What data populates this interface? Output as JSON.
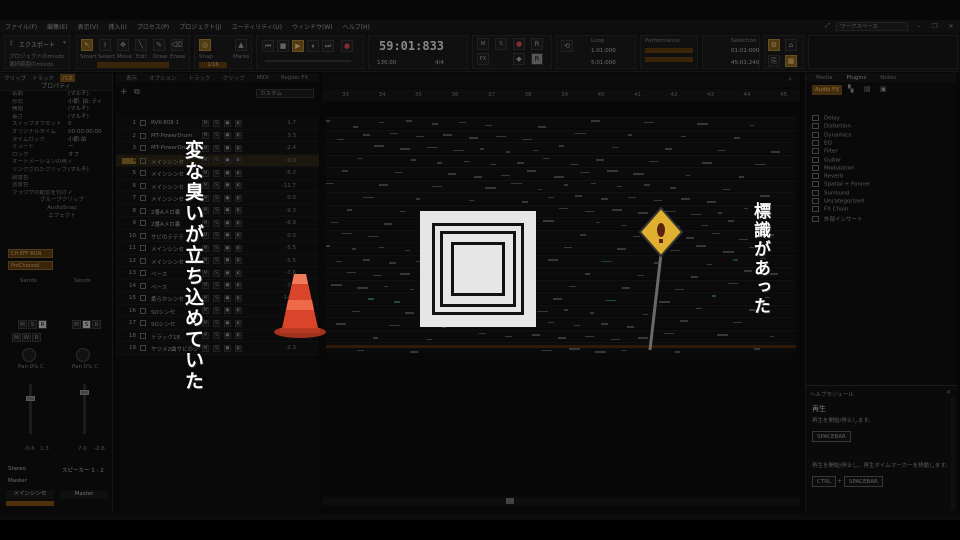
{
  "menu": [
    "ファイル(F)",
    "編集(E)",
    "表示(V)",
    "挿入(I)",
    "プロセス(P)",
    "プロジェクト(J)",
    "ユーティリティ(U)",
    "ウィンドウ(W)",
    "ヘルプ(H)"
  ],
  "workspace": "ワークスペース",
  "toolbar": {
    "export_label": "エクスポート",
    "opt1": "プロジェクトのmixdo",
    "opt2": "選択範囲のmixdo",
    "tools": [
      "Smart",
      "Select",
      "Move",
      "Edit",
      "Draw",
      "Erase"
    ],
    "snap_label": "Snap",
    "snap_value": "1/16",
    "marks_label": "Marks",
    "time": "59:01:833",
    "tempo": "130.00",
    "meter": "4/4",
    "loop_label": "Loop",
    "loop_start": "1:01:000",
    "loop_end": "5:01:000",
    "performance_label": "Performance",
    "selection_label": "Selection",
    "sel_start": "01:01:000",
    "sel_end": "45:01:240"
  },
  "inspector": {
    "tabs": [
      "クリップ",
      "トラック",
      "バス"
    ],
    "title": "プロパティ",
    "rows": [
      {
        "k": "名前",
        "v": "(マルチ)"
      },
      {
        "k": "形式",
        "v": "小節: 拍: ティ"
      },
      {
        "k": "開始",
        "v": "(マルチ)"
      },
      {
        "k": "長さ",
        "v": "(マルチ)"
      },
      {
        "k": "ステップオフセット",
        "v": "0"
      },
      {
        "k": "オリジナルタイム",
        "v": "00:00:00:00"
      },
      {
        "k": "タイムロック",
        "v": "小節:拍"
      },
      {
        "k": "ミュート",
        "v": "ー"
      },
      {
        "k": "ロック",
        "v": "オフ"
      },
      {
        "k": "オートメーションの再生",
        "v": "✓"
      },
      {
        "k": "リンクされたクリップ",
        "v": "(マルチ)"
      },
      {
        "k": "前景色",
        "v": ""
      },
      {
        "k": "背景色",
        "v": ""
      },
      {
        "k": "ブラウザの配色を付ける",
        "v": "✓"
      }
    ],
    "groove_label": "グルーブクリップ",
    "audiosnap_label": "AudioSnap",
    "effects_label": "エフェクト",
    "fx_chain": [
      "CH EFF RUN",
      "ProChannel"
    ]
  },
  "mixer": {
    "sends": [
      "Sends",
      "Sends"
    ],
    "pan_label": "Pan 0% C",
    "levels": [
      [
        "-0.6",
        "1.3"
      ],
      [
        "7.0",
        "-2.6"
      ]
    ],
    "input": "Stereo",
    "output_left": "Master",
    "output_right": "スピーカー 1 - 2",
    "ch_names": [
      "メインシンセ",
      "Master"
    ]
  },
  "tracks": {
    "tabs": [
      "表示",
      "オプション",
      "トラック",
      "クリップ",
      "MIDI",
      "Region FX"
    ],
    "search_placeholder": "カスタム",
    "rows": [
      {
        "n": "1",
        "name": "RVK-808 1",
        "vol": "1.7"
      },
      {
        "n": "2",
        "name": "MT-PowerDrum",
        "vol": "3.3"
      },
      {
        "n": "3",
        "name": "MT-PowerDrum",
        "vol": "-2.4"
      },
      {
        "n": "4",
        "name": "メインシンセ",
        "vol": "0.0"
      },
      {
        "n": "5",
        "name": "メインシンセ",
        "vol": "-8.2"
      },
      {
        "n": "6",
        "name": "メインシンセ",
        "vol": "-11.7"
      },
      {
        "n": "7",
        "name": "メインシンセ",
        "vol": "0.0"
      },
      {
        "n": "8",
        "name": "2番Aメロ裏",
        "vol": "-9.3"
      },
      {
        "n": "9",
        "name": "2番Aメロ裏",
        "vol": "-6.9"
      },
      {
        "n": "10",
        "name": "サビのテテテ",
        "vol": "0.0"
      },
      {
        "n": "11",
        "name": "メインシンセ",
        "vol": "-5.5"
      },
      {
        "n": "12",
        "name": "メインシンセ",
        "vol": "-5.5"
      },
      {
        "n": "13",
        "name": "ベース",
        "vol": "-7.6"
      },
      {
        "n": "14",
        "name": "ベース",
        "vol": "-7.6"
      },
      {
        "n": "15",
        "name": "柔らかシンセ",
        "vol": "-14.2"
      },
      {
        "n": "16",
        "name": "SOシンセ",
        "vol": "-9.5"
      },
      {
        "n": "17",
        "name": "SOシンセ",
        "vol": "-7.5"
      },
      {
        "n": "18",
        "name": "トラック18",
        "vol": "0.0"
      },
      {
        "n": "19",
        "name": "ヤツメ2曲サビのシ",
        "vol": "-2.3"
      }
    ]
  },
  "ruler": [
    "33",
    "34",
    "35",
    "36",
    "37",
    "38",
    "39",
    "40",
    "41",
    "42",
    "43",
    "44",
    "45"
  ],
  "browser": {
    "tabs": [
      "Media",
      "Plugins",
      "Notes"
    ],
    "category": "Audio FX",
    "items": [
      "Delay",
      "Distortion",
      "Dynamics",
      "EQ",
      "Filter",
      "Guitar",
      "Modulation",
      "Reverb",
      "Spatial + Panner",
      "Surround",
      "Uncategorized",
      "FX Chain",
      "外部インサート"
    ]
  },
  "help": {
    "title": "ヘルプモジュール",
    "heading": "再生",
    "desc1": "再生を開始/停止します。",
    "key1": "SPACEBAR",
    "desc2": "再生を開始/停止し、再生タイムマーカーを移動します。",
    "key2a": "CTRL",
    "plus": "+",
    "key2b": "SPACEBAR"
  },
  "overlay": {
    "text_left": "変な臭いが立ち込めていた",
    "text_right": "標識があった"
  }
}
